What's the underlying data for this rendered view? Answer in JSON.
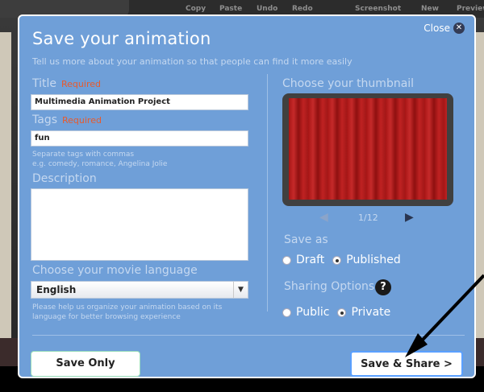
{
  "background_toolbar": {
    "items": [
      "Copy",
      "Paste",
      "Undo",
      "Redo",
      "Screenshot",
      "New",
      "Preview"
    ]
  },
  "dialog": {
    "title": "Save your animation",
    "close_label": "Close",
    "subtitle": "Tell us more about your animation so that people can find it more easily",
    "title_field": {
      "label": "Title",
      "required": "Required",
      "value": "Multimedia Animation Project"
    },
    "tags_field": {
      "label": "Tags",
      "required": "Required",
      "value": "fun",
      "hint_line1": "Separate tags with commas",
      "hint_line2": "e.g. comedy, romance, Angelina Jolie"
    },
    "description_field": {
      "label": "Description",
      "value": ""
    },
    "language": {
      "label": "Choose your movie language",
      "selected": "English",
      "hint_line1": "Please help us organize your animation based on its",
      "hint_line2": "language for better browsing experience"
    },
    "thumbnail": {
      "label": "Choose your thumbnail",
      "counter": "1/12"
    },
    "save_as": {
      "label": "Save as",
      "options": [
        "Draft",
        "Published"
      ],
      "selected": "Published"
    },
    "sharing": {
      "label": "Sharing Options",
      "help": "?",
      "options": [
        "Public",
        "Private"
      ],
      "selected": "Private"
    },
    "buttons": {
      "save_only": "Save Only",
      "save_share": "Save & Share >"
    }
  },
  "colors": {
    "dialog_bg": "#6f9fd8",
    "required": "#e85a2c",
    "thumbnail": "#b01c1c",
    "primary_border": "#5aa0ff"
  }
}
